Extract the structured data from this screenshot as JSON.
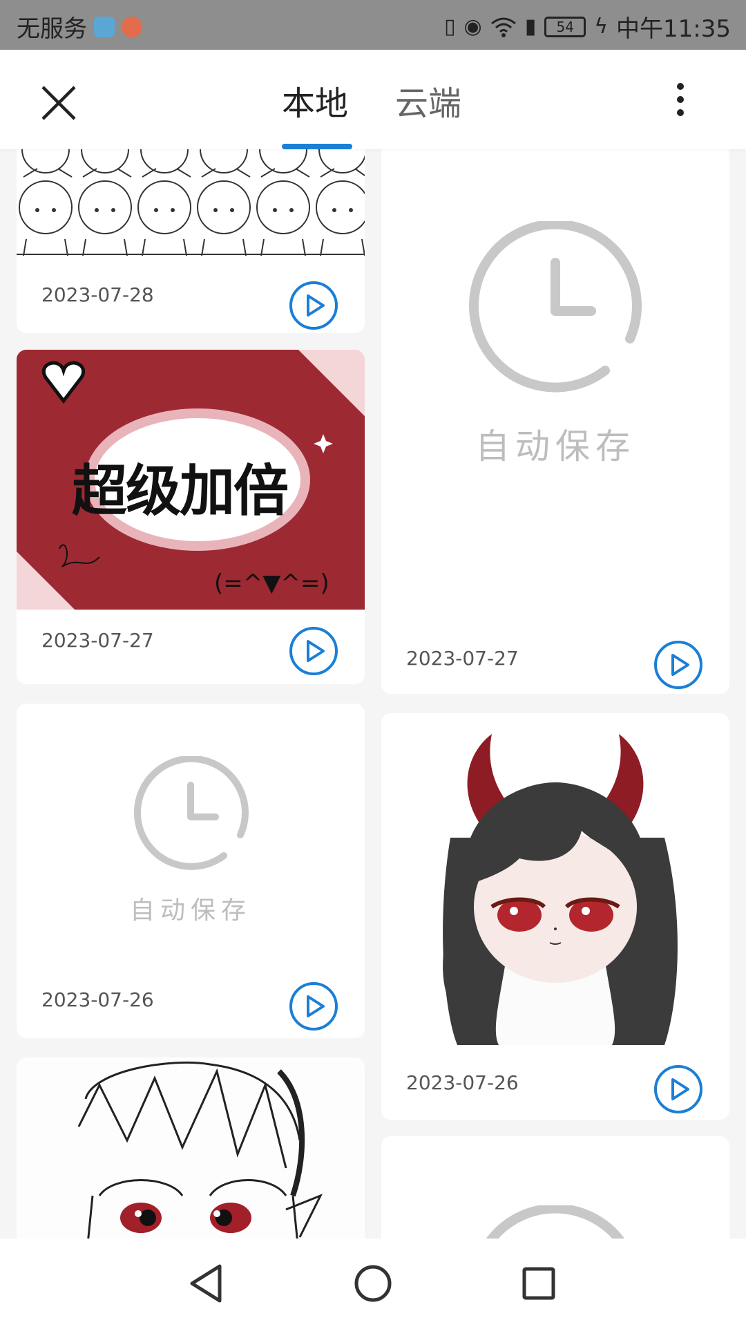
{
  "status_bar": {
    "carrier": "无服务",
    "battery": "54",
    "time": "中午11:35"
  },
  "header": {
    "tabs": [
      {
        "label": "本地",
        "active": true
      },
      {
        "label": "云端",
        "active": false
      }
    ],
    "accent_color": "#1a7fd6"
  },
  "autosave_label": "自动保存",
  "cards": [
    {
      "date": "2023-07-28"
    },
    {
      "date": "2023-07-27",
      "thumb_text": "超级加倍",
      "emoticon": "(=^▼^=)"
    },
    {
      "date": "2023-07-27"
    },
    {
      "date": "2023-07-26"
    },
    {
      "date": "2023-07-26"
    }
  ]
}
